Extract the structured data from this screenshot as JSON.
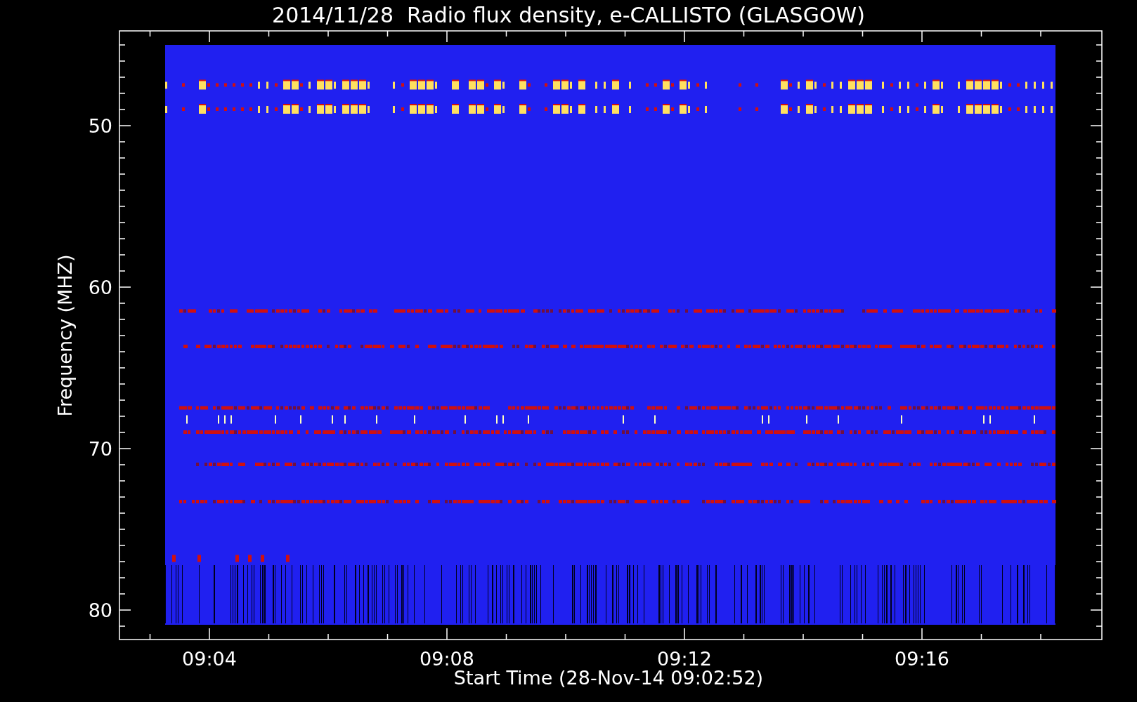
{
  "title": "2014/11/28  Radio flux density, e-CALLISTO (GLASGOW)",
  "y_axis": {
    "label": "Frequency (MHZ)",
    "ticks": [
      "50",
      "60",
      "70",
      "80"
    ]
  },
  "x_axis": {
    "label": "Start Time (28-Nov-14 09:02:52)",
    "ticks": [
      "09:04",
      "09:08",
      "09:12",
      "09:16"
    ]
  }
}
